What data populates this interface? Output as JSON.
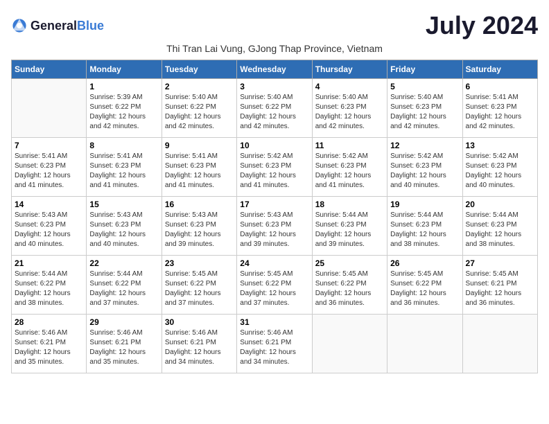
{
  "logo": {
    "general": "General",
    "blue": "Blue"
  },
  "title": "July 2024",
  "subtitle": "Thi Tran Lai Vung, GJong Thap Province, Vietnam",
  "days_of_week": [
    "Sunday",
    "Monday",
    "Tuesday",
    "Wednesday",
    "Thursday",
    "Friday",
    "Saturday"
  ],
  "weeks": [
    [
      {
        "day": "",
        "info": ""
      },
      {
        "day": "1",
        "info": "Sunrise: 5:39 AM\nSunset: 6:22 PM\nDaylight: 12 hours\nand 42 minutes."
      },
      {
        "day": "2",
        "info": "Sunrise: 5:40 AM\nSunset: 6:22 PM\nDaylight: 12 hours\nand 42 minutes."
      },
      {
        "day": "3",
        "info": "Sunrise: 5:40 AM\nSunset: 6:22 PM\nDaylight: 12 hours\nand 42 minutes."
      },
      {
        "day": "4",
        "info": "Sunrise: 5:40 AM\nSunset: 6:23 PM\nDaylight: 12 hours\nand 42 minutes."
      },
      {
        "day": "5",
        "info": "Sunrise: 5:40 AM\nSunset: 6:23 PM\nDaylight: 12 hours\nand 42 minutes."
      },
      {
        "day": "6",
        "info": "Sunrise: 5:41 AM\nSunset: 6:23 PM\nDaylight: 12 hours\nand 42 minutes."
      }
    ],
    [
      {
        "day": "7",
        "info": "Sunrise: 5:41 AM\nSunset: 6:23 PM\nDaylight: 12 hours\nand 41 minutes."
      },
      {
        "day": "8",
        "info": "Sunrise: 5:41 AM\nSunset: 6:23 PM\nDaylight: 12 hours\nand 41 minutes."
      },
      {
        "day": "9",
        "info": "Sunrise: 5:41 AM\nSunset: 6:23 PM\nDaylight: 12 hours\nand 41 minutes."
      },
      {
        "day": "10",
        "info": "Sunrise: 5:42 AM\nSunset: 6:23 PM\nDaylight: 12 hours\nand 41 minutes."
      },
      {
        "day": "11",
        "info": "Sunrise: 5:42 AM\nSunset: 6:23 PM\nDaylight: 12 hours\nand 41 minutes."
      },
      {
        "day": "12",
        "info": "Sunrise: 5:42 AM\nSunset: 6:23 PM\nDaylight: 12 hours\nand 40 minutes."
      },
      {
        "day": "13",
        "info": "Sunrise: 5:42 AM\nSunset: 6:23 PM\nDaylight: 12 hours\nand 40 minutes."
      }
    ],
    [
      {
        "day": "14",
        "info": "Sunrise: 5:43 AM\nSunset: 6:23 PM\nDaylight: 12 hours\nand 40 minutes."
      },
      {
        "day": "15",
        "info": "Sunrise: 5:43 AM\nSunset: 6:23 PM\nDaylight: 12 hours\nand 40 minutes."
      },
      {
        "day": "16",
        "info": "Sunrise: 5:43 AM\nSunset: 6:23 PM\nDaylight: 12 hours\nand 39 minutes."
      },
      {
        "day": "17",
        "info": "Sunrise: 5:43 AM\nSunset: 6:23 PM\nDaylight: 12 hours\nand 39 minutes."
      },
      {
        "day": "18",
        "info": "Sunrise: 5:44 AM\nSunset: 6:23 PM\nDaylight: 12 hours\nand 39 minutes."
      },
      {
        "day": "19",
        "info": "Sunrise: 5:44 AM\nSunset: 6:23 PM\nDaylight: 12 hours\nand 38 minutes."
      },
      {
        "day": "20",
        "info": "Sunrise: 5:44 AM\nSunset: 6:23 PM\nDaylight: 12 hours\nand 38 minutes."
      }
    ],
    [
      {
        "day": "21",
        "info": "Sunrise: 5:44 AM\nSunset: 6:22 PM\nDaylight: 12 hours\nand 38 minutes."
      },
      {
        "day": "22",
        "info": "Sunrise: 5:44 AM\nSunset: 6:22 PM\nDaylight: 12 hours\nand 37 minutes."
      },
      {
        "day": "23",
        "info": "Sunrise: 5:45 AM\nSunset: 6:22 PM\nDaylight: 12 hours\nand 37 minutes."
      },
      {
        "day": "24",
        "info": "Sunrise: 5:45 AM\nSunset: 6:22 PM\nDaylight: 12 hours\nand 37 minutes."
      },
      {
        "day": "25",
        "info": "Sunrise: 5:45 AM\nSunset: 6:22 PM\nDaylight: 12 hours\nand 36 minutes."
      },
      {
        "day": "26",
        "info": "Sunrise: 5:45 AM\nSunset: 6:22 PM\nDaylight: 12 hours\nand 36 minutes."
      },
      {
        "day": "27",
        "info": "Sunrise: 5:45 AM\nSunset: 6:21 PM\nDaylight: 12 hours\nand 36 minutes."
      }
    ],
    [
      {
        "day": "28",
        "info": "Sunrise: 5:46 AM\nSunset: 6:21 PM\nDaylight: 12 hours\nand 35 minutes."
      },
      {
        "day": "29",
        "info": "Sunrise: 5:46 AM\nSunset: 6:21 PM\nDaylight: 12 hours\nand 35 minutes."
      },
      {
        "day": "30",
        "info": "Sunrise: 5:46 AM\nSunset: 6:21 PM\nDaylight: 12 hours\nand 34 minutes."
      },
      {
        "day": "31",
        "info": "Sunrise: 5:46 AM\nSunset: 6:21 PM\nDaylight: 12 hours\nand 34 minutes."
      },
      {
        "day": "",
        "info": ""
      },
      {
        "day": "",
        "info": ""
      },
      {
        "day": "",
        "info": ""
      }
    ]
  ]
}
